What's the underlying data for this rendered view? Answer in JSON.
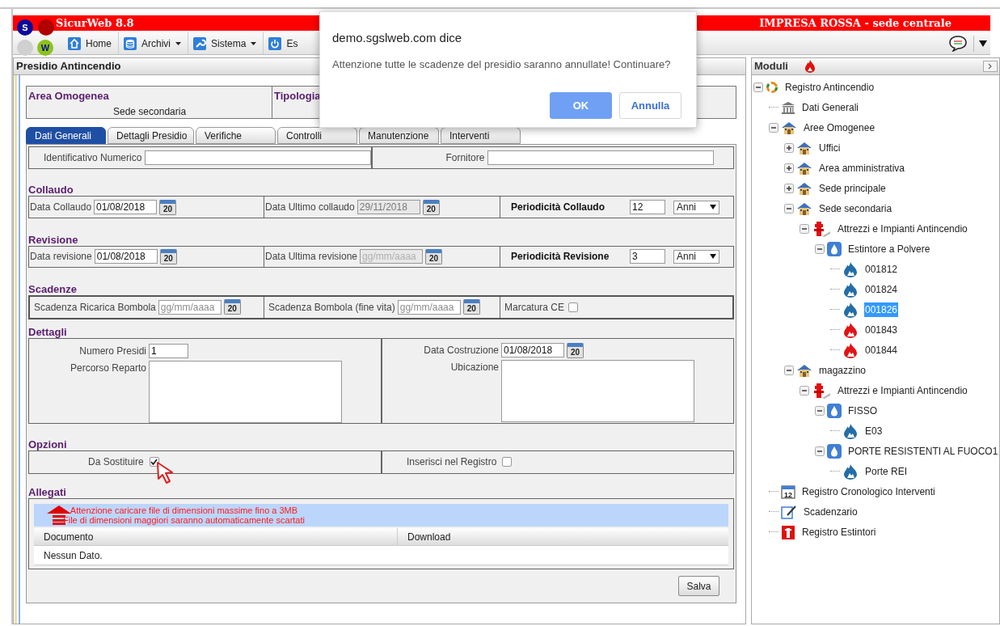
{
  "app": {
    "title": "SicurWeb 8.8",
    "company": "IMPRESA ROSSA - sede centrale",
    "logo_letters": [
      "S",
      "W"
    ]
  },
  "menu": [
    {
      "label": "Home",
      "kind": "home",
      "caret": false
    },
    {
      "label": "Archivi",
      "kind": "database",
      "caret": true
    },
    {
      "label": "Sistema",
      "kind": "wrench",
      "caret": true
    },
    {
      "label": "Es",
      "kind": "power",
      "caret": false
    }
  ],
  "panel": {
    "title": "Presidio Antincendio"
  },
  "header_fields": [
    {
      "label": "Area Omogenea",
      "value": "Sede secondaria"
    },
    {
      "label": "Tipologia"
    }
  ],
  "tabs": [
    {
      "label": "Dati Generali",
      "selected": true
    },
    {
      "label": "Dettagli Presidio",
      "selected": false
    },
    {
      "label": "Verifiche",
      "selected": false
    },
    {
      "label": "Controlli",
      "selected": false
    },
    {
      "label": "Manutenzione",
      "selected": false
    },
    {
      "label": "Interventi",
      "selected": false
    }
  ],
  "top_fields": [
    {
      "label": "Identificativo Numerico"
    },
    {
      "label": "Fornitore"
    }
  ],
  "periodic_sections": [
    {
      "title": "Collaudo",
      "date": {
        "label": "Data Collaudo",
        "value": "01/08/2018",
        "disabled": false,
        "calendar": "20"
      },
      "last": {
        "label": "Data Ultimo collaudo",
        "value": "29/11/2018",
        "disabled": true,
        "calendar": "20"
      },
      "period": {
        "label": "Periodicità Collaudo",
        "value": "12",
        "unit": "Anni"
      }
    },
    {
      "title": "Revisione",
      "date": {
        "label": "Data revisione",
        "value": "01/08/2018",
        "disabled": false,
        "calendar": "20"
      },
      "last": {
        "label": "Data Ultima revisione",
        "placeholder": "gg/mm/aaaa",
        "disabled": true,
        "calendar": "20"
      },
      "period": {
        "label": "Periodicità Revisione",
        "value": "3",
        "unit": "Anni"
      }
    }
  ],
  "scadenze": {
    "title": "Scadenze",
    "fields": [
      {
        "label": "Scadenza Ricarica Bombola",
        "placeholder": "gg/mm/aaaa",
        "disabled": false,
        "calendar": "20"
      },
      {
        "label": "Scadenza Bombola (fine vita)",
        "placeholder": "gg/mm/aaaa",
        "disabled": false,
        "calendar": "20"
      }
    ],
    "checkbox": {
      "label": "Marcatura CE",
      "checked": false
    }
  },
  "dettagli": {
    "title": "Dettagli",
    "numero": {
      "label": "Numero Presidi",
      "value": "1"
    },
    "percorso": {
      "label": "Percorso Reparto"
    },
    "costruzione": {
      "label": "Data Costruzione",
      "value": "01/08/2018",
      "disabled": false,
      "calendar": "20"
    },
    "ubicazione": {
      "label": "Ubicazione"
    }
  },
  "opzioni": {
    "title": "Opzioni",
    "checkboxes": [
      {
        "label": "Da Sostituire",
        "checked": true
      },
      {
        "label": "Inserisci nel Registro",
        "checked": false
      }
    ]
  },
  "allegati": {
    "title": "Allegati",
    "warning": [
      "Attenzione caricare file di dimensioni massime fino a 3MB",
      "File di dimensioni maggiori saranno automaticamente scartati"
    ],
    "columns": [
      "Documento",
      "Download"
    ],
    "empty": "Nessun Dato."
  },
  "save_button": "Salva",
  "sidebar": {
    "title": "Moduli",
    "tree": [
      {
        "label": "Registro Antincendio",
        "kind": "registry",
        "expanded": true,
        "selected": false,
        "children": [
          {
            "label": "Dati Generali",
            "kind": "bank",
            "selected": false
          },
          {
            "label": "Aree Omogenee",
            "kind": "house",
            "expanded": true,
            "selected": false,
            "children": [
              {
                "label": "Uffici",
                "kind": "house",
                "expanded": false,
                "selected": false
              },
              {
                "label": "Area amministrativa",
                "kind": "house",
                "expanded": false,
                "selected": false
              },
              {
                "label": "Sede principale",
                "kind": "house",
                "expanded": false,
                "selected": false
              },
              {
                "label": "Sede secondaria",
                "kind": "house",
                "expanded": true,
                "selected": false,
                "children": [
                  {
                    "label": "Attrezzi e Impianti Antincendio",
                    "kind": "hydrant",
                    "expanded": true,
                    "selected": false,
                    "children": [
                      {
                        "label": "Estintore a Polvere",
                        "kind": "drop",
                        "expanded": true,
                        "selected": false,
                        "children": [
                          {
                            "label": "001812",
                            "kind": "flame_blue",
                            "selected": false
                          },
                          {
                            "label": "001824",
                            "kind": "flame_blue",
                            "selected": false
                          },
                          {
                            "label": "001826",
                            "kind": "flame_blue",
                            "selected": true
                          },
                          {
                            "label": "001843",
                            "kind": "flame_red",
                            "selected": false
                          },
                          {
                            "label": "001844",
                            "kind": "flame_red",
                            "selected": false
                          }
                        ]
                      }
                    ]
                  }
                ]
              },
              {
                "label": "magazzino",
                "kind": "house",
                "expanded": true,
                "selected": false,
                "children": [
                  {
                    "label": "Attrezzi e Impianti Antincendio",
                    "kind": "hydrant",
                    "expanded": true,
                    "selected": false,
                    "children": [
                      {
                        "label": "FISSO",
                        "kind": "drop",
                        "expanded": true,
                        "selected": false,
                        "children": [
                          {
                            "label": "E03",
                            "kind": "flame_blue",
                            "selected": false
                          }
                        ]
                      },
                      {
                        "label": "PORTE RESISTENTI AL FUOCO1",
                        "kind": "drop",
                        "expanded": true,
                        "selected": false,
                        "children": [
                          {
                            "label": "Porte REI",
                            "kind": "flame_blue",
                            "selected": false
                          }
                        ]
                      }
                    ]
                  }
                ]
              }
            ]
          },
          {
            "label": "Registro Cronologico Interventi",
            "kind": "calendar",
            "icon_text": "12",
            "selected": false
          },
          {
            "label": "Scadenzario",
            "kind": "note",
            "selected": false
          },
          {
            "label": "Registro Estintori",
            "kind": "red_box",
            "selected": false
          }
        ]
      }
    ]
  },
  "dialog": {
    "origin": "demo.sgslweb.com dice",
    "message": "Attenzione tutte le scadenze del presidio saranno annullate! Continuare?",
    "buttons": [
      {
        "label": "OK",
        "kind": "primary"
      },
      {
        "label": "Annulla",
        "kind": "secondary"
      }
    ]
  }
}
